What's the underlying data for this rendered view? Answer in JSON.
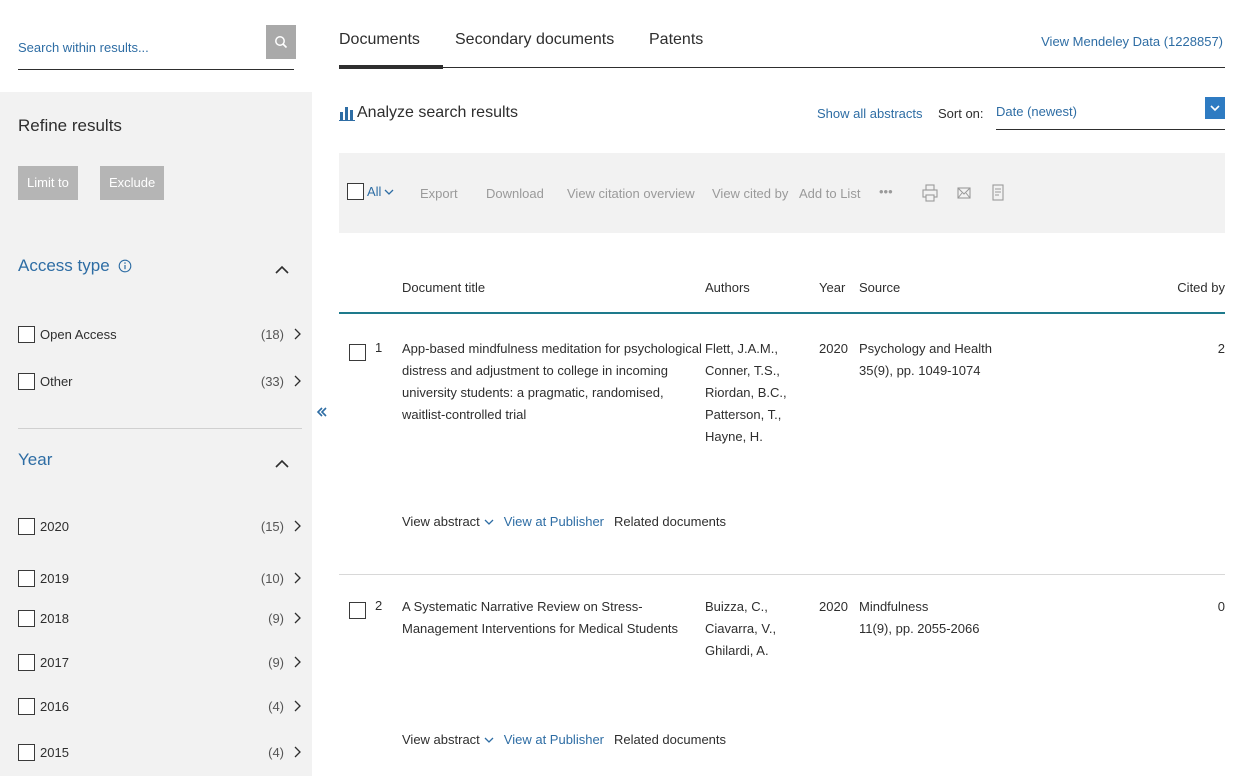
{
  "sidebar": {
    "search_placeholder": "Search within results...",
    "refine_title": "Refine results",
    "limit_label": "Limit to",
    "exclude_label": "Exclude",
    "access": {
      "title": "Access type",
      "items": [
        {
          "label": "Open Access",
          "count": "(18)"
        },
        {
          "label": "Other",
          "count": "(33)"
        }
      ]
    },
    "year": {
      "title": "Year",
      "items": [
        {
          "label": "2020",
          "count": "(15)"
        },
        {
          "label": "2019",
          "count": "(10)"
        },
        {
          "label": "2018",
          "count": "(9)"
        },
        {
          "label": "2017",
          "count": "(9)"
        },
        {
          "label": "2016",
          "count": "(4)"
        },
        {
          "label": "2015",
          "count": "(4)"
        }
      ]
    }
  },
  "tabs": {
    "documents": "Documents",
    "secondary": "Secondary documents",
    "patents": "Patents",
    "mendeley": "View Mendeley Data (1228857)"
  },
  "results_bar": {
    "analyze": "Analyze search results",
    "show_abstracts": "Show all abstracts",
    "sort_label": "Sort on:",
    "sort_value": "Date (newest)"
  },
  "toolbar": {
    "all": "All",
    "export": "Export",
    "download": "Download",
    "citation_overview": "View citation overview",
    "cited_by": "View cited by",
    "add_to_list": "Add to List",
    "more": "•••"
  },
  "columns": {
    "title": "Document title",
    "authors": "Authors",
    "year": "Year",
    "source": "Source",
    "cited": "Cited by"
  },
  "documents": [
    {
      "num": "1",
      "title": "App-based mindfulness meditation for psychological distress and adjustment to college in incoming university students: a pragmatic, randomised, waitlist-controlled trial",
      "authors": [
        "Flett, J.A.M.,",
        "Conner, T.S.,",
        "Riordan, B.C.,",
        "Patterson, T.,",
        "Hayne, H."
      ],
      "year": "2020",
      "source_title": "Psychology and Health",
      "source_detail": "35(9), pp. 1049-1074",
      "cited": "2"
    },
    {
      "num": "2",
      "title": "A Systematic Narrative Review on Stress-Management Interventions for Medical Students",
      "authors": [
        "Buizza, C.,",
        "Ciavarra, V.,",
        "Ghilardi, A."
      ],
      "year": "2020",
      "source_title": "Mindfulness",
      "source_detail": "11(9), pp. 2055-2066",
      "cited": "0"
    }
  ],
  "row_links": {
    "view_abstract": "View abstract",
    "view_publisher": "View at Publisher",
    "related": "Related documents"
  },
  "colors": {
    "link": "#2e6da4",
    "accent_teal": "#1e7a8c",
    "sort_button": "#2e7bc2"
  }
}
